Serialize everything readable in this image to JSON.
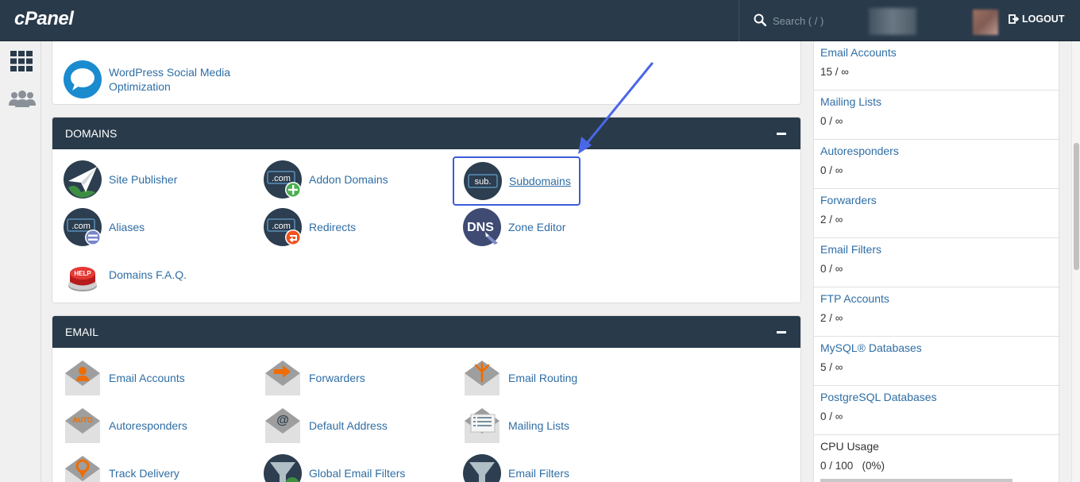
{
  "header": {
    "logo": "cPanel",
    "search_placeholder": "Search ( / )",
    "logout_label": "LOGOUT"
  },
  "top_panel": {
    "items": [
      {
        "label_line1": "WordPress Social Media",
        "label_line2": "Optimization",
        "icon": "speech-bubble-icon"
      }
    ]
  },
  "domains": {
    "title": "DOMAINS",
    "items": [
      {
        "label": "Site Publisher",
        "icon": "paper-plane-globe-icon"
      },
      {
        "label": "Addon Domains",
        "icon": "com-plus-icon"
      },
      {
        "label": "Subdomains",
        "icon": "sub-domain-icon",
        "highlighted": true
      },
      {
        "label": "Aliases",
        "icon": "com-equals-icon"
      },
      {
        "label": "Redirects",
        "icon": "com-redirect-icon"
      },
      {
        "label": "Zone Editor",
        "icon": "dns-icon"
      },
      {
        "label": "Domains F.A.Q.",
        "icon": "help-button-icon"
      }
    ],
    "icon_texts": {
      "com": ".com",
      "sub": "sub.",
      "dns": "DNS",
      "help": "HELP"
    }
  },
  "email": {
    "title": "EMAIL",
    "items": [
      {
        "label": "Email Accounts",
        "icon": "envelope-person-icon"
      },
      {
        "label": "Forwarders",
        "icon": "envelope-arrow-icon"
      },
      {
        "label": "Email Routing",
        "icon": "envelope-fork-icon"
      },
      {
        "label": "Autoresponders",
        "icon": "envelope-auto-icon"
      },
      {
        "label": "Default Address",
        "icon": "envelope-at-icon"
      },
      {
        "label": "Mailing Lists",
        "icon": "envelope-list-icon"
      },
      {
        "label": "Track Delivery",
        "icon": "envelope-pin-icon"
      },
      {
        "label": "Global Email Filters",
        "icon": "filter-globe-icon"
      },
      {
        "label": "Email Filters",
        "icon": "filter-icon"
      }
    ],
    "icon_texts": {
      "auto": "AUTO",
      "at": "@"
    }
  },
  "stats": [
    {
      "label": "Email Accounts",
      "value": "15 / ∞"
    },
    {
      "label": "Mailing Lists",
      "value": "0 / ∞"
    },
    {
      "label": "Autoresponders",
      "value": "0 / ∞"
    },
    {
      "label": "Forwarders",
      "value": "2 / ∞"
    },
    {
      "label": "Email Filters",
      "value": "0 / ∞"
    },
    {
      "label": "FTP Accounts",
      "value": "2 / ∞"
    },
    {
      "label": "MySQL® Databases",
      "value": "5 / ∞"
    },
    {
      "label": "PostgreSQL Databases",
      "value": "0 / ∞"
    },
    {
      "label": "CPU Usage",
      "value": "0 / 100   (0%)"
    }
  ],
  "colors": {
    "header_bg": "#293a4a",
    "link": "#2f6ea5",
    "highlight": "#3b5bdb",
    "annotation_arrow": "#4a67e8"
  }
}
